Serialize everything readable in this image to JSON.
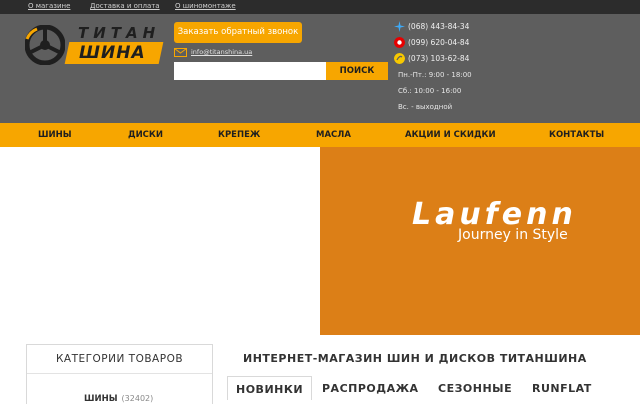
{
  "topbar": {
    "links": [
      "О магазине",
      "Доставка и оплата",
      "О шиномонтаже"
    ]
  },
  "logo": {
    "line1": "ТИТАН",
    "line2": "ШИНА"
  },
  "header": {
    "callback_label": "Заказать обратный звонок",
    "email": "info@titanshina.ua",
    "search_placeholder": "",
    "search_button": "ПОИСК",
    "phones": [
      {
        "number": "(068) 443-84-34",
        "operator": "kyivstar-icon",
        "color": "#3fa9f5"
      },
      {
        "number": "(099) 620-04-84",
        "operator": "vodafone-icon",
        "color": "#e60000"
      },
      {
        "number": "(073) 103-62-84",
        "operator": "lifecell-icon",
        "color": "#f7c800"
      }
    ],
    "hours": [
      "Пн.-Пт.: 9:00 - 18:00",
      "Сб.: 10:00 - 16:00",
      "Вс. - выходной"
    ]
  },
  "nav": {
    "items": [
      "ШИНЫ",
      "ДИСКИ",
      "КРЕПЕЖ",
      "МАСЛА",
      "АКЦИИ И СКИДКИ",
      "КОНТАКТЫ"
    ]
  },
  "banner": {
    "brand": "Laufenn",
    "slogan": "Journey in Style"
  },
  "categories": {
    "title": "КАТЕГОРИИ ТОВАРОВ",
    "items": [
      {
        "name": "ШИНЫ",
        "count": "(32402)"
      }
    ]
  },
  "main": {
    "title": "ИНТЕРНЕТ-МАГАЗИН ШИН И ДИСКОВ ТИТАНШИНА",
    "tabs": [
      "НОВИНКИ",
      "РАСПРОДАЖА",
      "СЕЗОННЫЕ",
      "RUNFLAT"
    ]
  },
  "colors": {
    "accent": "#f7a600",
    "header_bg": "#5e5e5e",
    "topbar_bg": "#2c2c2c",
    "banner_bg": "#dc7f17"
  }
}
